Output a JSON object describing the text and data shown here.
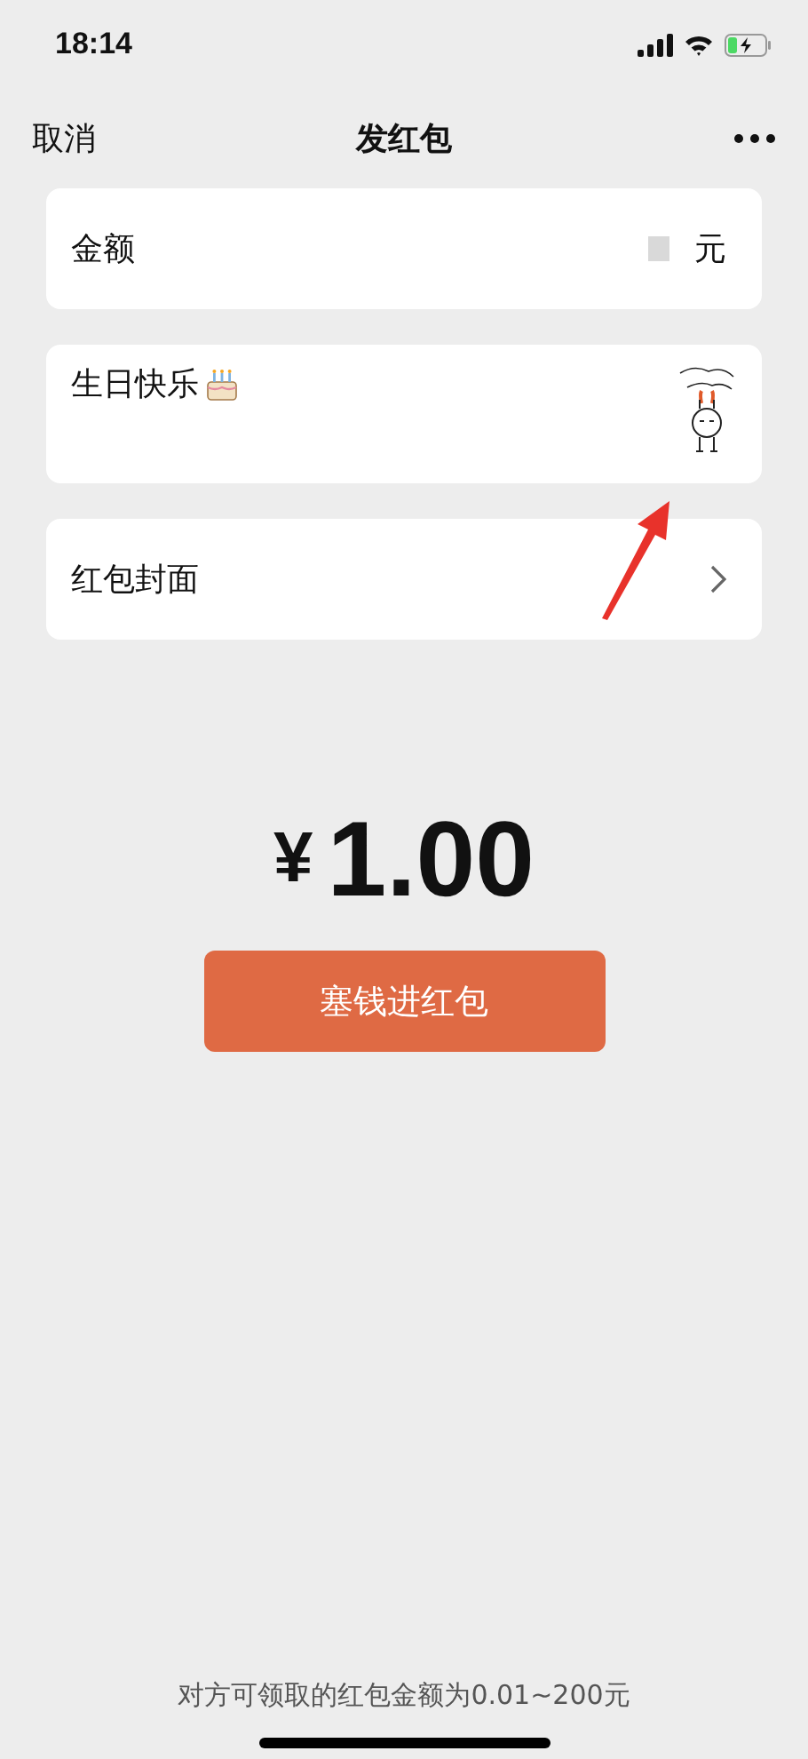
{
  "status_bar": {
    "time": "18:14"
  },
  "nav": {
    "left": "取消",
    "title": "发红包"
  },
  "amount_row": {
    "label": "金额",
    "unit": "元"
  },
  "message_row": {
    "text": "生日快乐"
  },
  "cover_row": {
    "label": "红包封面"
  },
  "total": {
    "currency": "¥",
    "amount": "1.00"
  },
  "submit_button": "塞钱进红包",
  "footer_note": "对方可领取的红包金额为0.01~200元"
}
